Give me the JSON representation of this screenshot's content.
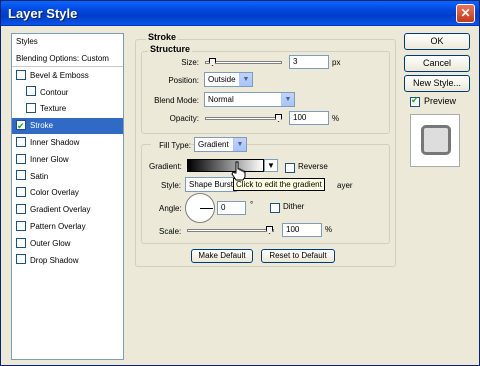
{
  "window": {
    "title": "Layer Style",
    "close_glyph": "✕"
  },
  "styles_list": [
    {
      "label": "Styles",
      "has_checkbox": false,
      "checked": false,
      "selected": false,
      "indent": false
    },
    {
      "label": "Blending Options: Custom",
      "has_checkbox": false,
      "checked": false,
      "selected": false,
      "indent": false
    },
    {
      "label": "Bevel & Emboss",
      "has_checkbox": true,
      "checked": false,
      "selected": false,
      "indent": false
    },
    {
      "label": "Contour",
      "has_checkbox": true,
      "checked": false,
      "selected": false,
      "indent": true
    },
    {
      "label": "Texture",
      "has_checkbox": true,
      "checked": false,
      "selected": false,
      "indent": true
    },
    {
      "label": "Stroke",
      "has_checkbox": true,
      "checked": true,
      "selected": true,
      "indent": false
    },
    {
      "label": "Inner Shadow",
      "has_checkbox": true,
      "checked": false,
      "selected": false,
      "indent": false
    },
    {
      "label": "Inner Glow",
      "has_checkbox": true,
      "checked": false,
      "selected": false,
      "indent": false
    },
    {
      "label": "Satin",
      "has_checkbox": true,
      "checked": false,
      "selected": false,
      "indent": false
    },
    {
      "label": "Color Overlay",
      "has_checkbox": true,
      "checked": false,
      "selected": false,
      "indent": false
    },
    {
      "label": "Gradient Overlay",
      "has_checkbox": true,
      "checked": false,
      "selected": false,
      "indent": false
    },
    {
      "label": "Pattern Overlay",
      "has_checkbox": true,
      "checked": false,
      "selected": false,
      "indent": false
    },
    {
      "label": "Outer Glow",
      "has_checkbox": true,
      "checked": false,
      "selected": false,
      "indent": false
    },
    {
      "label": "Drop Shadow",
      "has_checkbox": true,
      "checked": false,
      "selected": false,
      "indent": false
    }
  ],
  "stroke": {
    "group_title": "Stroke",
    "structure_title": "Structure",
    "size_label": "Size:",
    "size_value": "3",
    "size_unit": "px",
    "position_label": "Position:",
    "position_value": "Outside",
    "blend_mode_label": "Blend Mode:",
    "blend_mode_value": "Normal",
    "opacity_label": "Opacity:",
    "opacity_value": "100",
    "opacity_unit": "%",
    "fill_type_label": "Fill Type:",
    "fill_type_value": "Gradient",
    "gradient_label": "Gradient:",
    "reverse_label": "Reverse",
    "style_label": "Style:",
    "style_value": "Shape Burst",
    "align_suffix": "ayer",
    "angle_label": "Angle:",
    "angle_value": "0",
    "angle_unit": "°",
    "dither_label": "Dither",
    "scale_label": "Scale:",
    "scale_value": "100",
    "scale_unit": "%",
    "tooltip": "Click to edit the gradient",
    "make_default": "Make Default",
    "reset_default": "Reset to Default"
  },
  "buttons": {
    "ok": "OK",
    "cancel": "Cancel",
    "new_style": "New Style..."
  },
  "preview": {
    "label": "Preview",
    "checked": true
  },
  "colors": {
    "titlebar": "#0054e3",
    "selection": "#316ac5",
    "dialog_bg": "#ece9d8"
  }
}
